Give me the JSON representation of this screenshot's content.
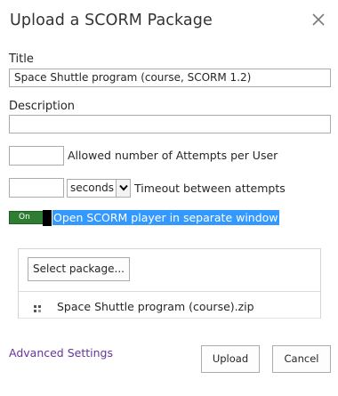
{
  "dialog": {
    "title": "Upload a SCORM Package"
  },
  "form": {
    "title_label": "Title",
    "title_value": "Space Shuttle program (course, SCORM 1.2)",
    "description_label": "Description",
    "description_value": "",
    "attempts_value": "",
    "attempts_label": "Allowed number of Attempts per User",
    "timeout_value": "",
    "timeout_unit": "seconds",
    "timeout_label": "Timeout between attempts",
    "toggle_state": "On",
    "separate_window_label": "Open SCORM player in separate window"
  },
  "package": {
    "select_button": "Select package...",
    "file_name": "Space Shuttle program (course).zip"
  },
  "footer": {
    "advanced_link": "Advanced Settings",
    "upload_button": "Upload",
    "cancel_button": "Cancel"
  },
  "colors": {
    "link": "#663399",
    "toggle_on": "#2e7d32",
    "highlight": "#3399ff"
  },
  "icons": {
    "close": "close-icon",
    "dropdown": "chevron-down-icon",
    "file": "file-icon"
  }
}
